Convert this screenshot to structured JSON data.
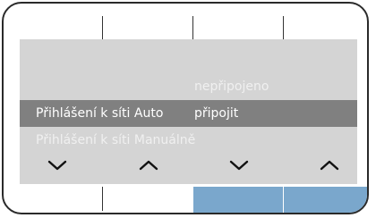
{
  "menu": {
    "items": [
      {
        "label": "",
        "value": "nepřipojeno",
        "state": "dim"
      },
      {
        "label": "Přihlášení k síti Auto",
        "value": "připojit",
        "state": "selected"
      },
      {
        "label": "Přihlášení k síti Manuálně",
        "value": "",
        "state": "dim"
      }
    ]
  },
  "nav": {
    "buttons": [
      {
        "icon": "chevron-down-icon"
      },
      {
        "icon": "chevron-up-icon"
      },
      {
        "icon": "chevron-down-icon"
      },
      {
        "icon": "chevron-up-icon"
      }
    ]
  },
  "colors": {
    "screen_bg": "#d4d4d4",
    "selected_bg": "#808080",
    "dim_text": "#f0f0f0",
    "softkey_active": "#7aa7cc"
  }
}
